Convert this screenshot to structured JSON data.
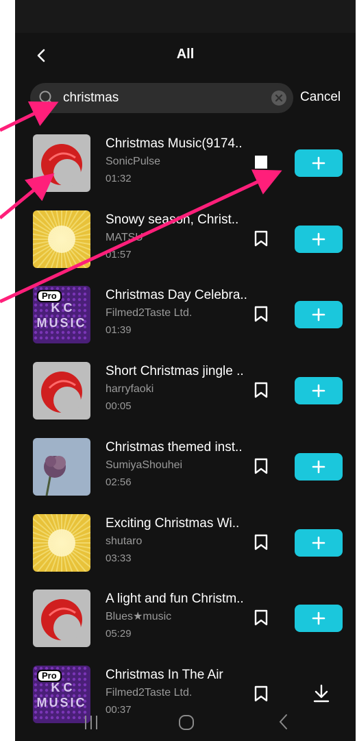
{
  "header": {
    "title": "All"
  },
  "search": {
    "value": "christmas",
    "cancel_label": "Cancel"
  },
  "tracks": [
    {
      "title": "Christmas Music(9174..",
      "artist": "SonicPulse",
      "duration": "01:32",
      "thumb": "red-arc",
      "action": "add"
    },
    {
      "title": "Snowy season, Christ..",
      "artist": "MATSU",
      "duration": "01:57",
      "thumb": "sunburst",
      "action": "add"
    },
    {
      "title": "Christmas Day Celebra..",
      "artist": "Filmed2Taste Ltd.",
      "duration": "01:39",
      "thumb": "pro-music",
      "action": "add"
    },
    {
      "title": "Short Christmas jingle ..",
      "artist": "harryfaoki",
      "duration": "00:05",
      "thumb": "red-arc",
      "action": "add"
    },
    {
      "title": "Christmas themed inst..",
      "artist": "SumiyaShouhei",
      "duration": "02:56",
      "thumb": "flower",
      "action": "add"
    },
    {
      "title": "Exciting Christmas Wi..",
      "artist": "shutaro",
      "duration": "03:33",
      "thumb": "sunburst",
      "action": "add"
    },
    {
      "title": "A light and fun Christm..",
      "artist": "Blues★music",
      "duration": "05:29",
      "thumb": "red-arc",
      "action": "add"
    },
    {
      "title": "Christmas In The Air",
      "artist": "Filmed2Taste Ltd.",
      "duration": "00:37",
      "thumb": "pro-music",
      "action": "download"
    }
  ],
  "badges": {
    "pro": "Pro",
    "music_art_top": "K C",
    "music_art_bottom": "MUSIC"
  },
  "colors": {
    "accent": "#1bc7dc",
    "background": "#131313",
    "annotation": "#ff1f7a"
  },
  "icons": [
    "back-icon",
    "search-icon",
    "clear-icon",
    "bookmark-icon",
    "plus-icon",
    "download-icon",
    "recents-icon",
    "home-icon",
    "nav-back-icon"
  ]
}
